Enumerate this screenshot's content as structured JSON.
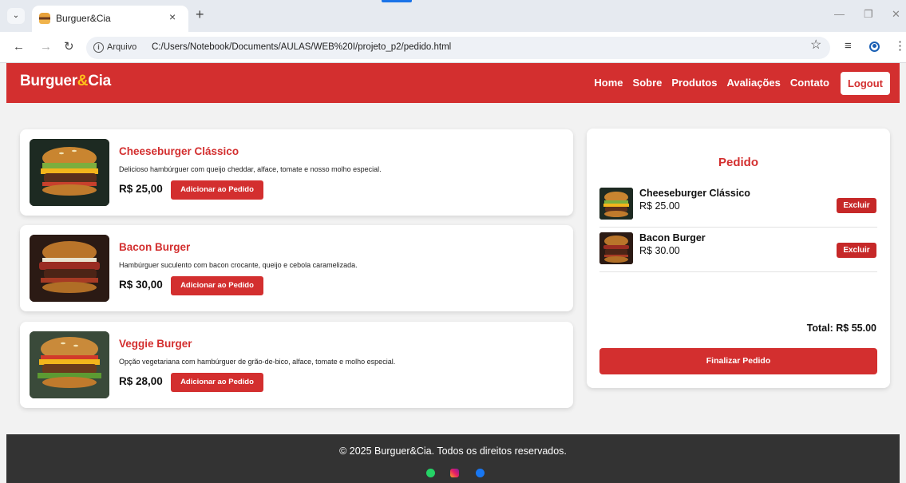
{
  "browser": {
    "tab_title": "Burguer&Cia",
    "tab_close": "×",
    "new_tab": "+",
    "info_label": "i",
    "security_label": "Arquivo",
    "url": "C:/Users/Notebook/Documents/AULAS/WEB%20I/projeto_p2/pedido.html"
  },
  "site": {
    "logo_prefix": "Burguer",
    "logo_amp": "&",
    "logo_suffix": "Cia",
    "brand_color": "#d32f2f",
    "accent_color": "#ffc21a"
  },
  "nav": {
    "items": [
      {
        "label": "Home"
      },
      {
        "label": "Sobre"
      },
      {
        "label": "Produtos"
      },
      {
        "label": "Avaliações"
      },
      {
        "label": "Contato"
      }
    ],
    "logout_label": "Logout"
  },
  "products": [
    {
      "name": "Cheeseburger Clássico",
      "description": "Delicioso hambúrguer com queijo cheddar, alface, tomate e nosso molho especial.",
      "price": "R$ 25,00",
      "button": "Adicionar ao Pedido"
    },
    {
      "name": "Bacon Burger",
      "description": "Hambúrguer suculento com bacon crocante, queijo e cebola caramelizada.",
      "price": "R$ 30,00",
      "button": "Adicionar ao Pedido"
    },
    {
      "name": "Veggie Burger",
      "description": "Opção vegetariana com hambúrguer de grão-de-bico, alface, tomate e molho especial.",
      "price": "R$ 28,00",
      "button": "Adicionar ao Pedido"
    }
  ],
  "order": {
    "title": "Pedido",
    "items": [
      {
        "name": "Cheeseburger Clássico",
        "price": "R$ 25.00",
        "button": "Excluir"
      },
      {
        "name": "Bacon Burger",
        "price": "R$ 30.00",
        "button": "Excluir"
      }
    ],
    "total": "Total: R$ 55.00",
    "finalize_label": "Finalizar Pedido"
  },
  "footer": {
    "copyright": "© 2025 Burguer&Cia. Todos os direitos reservados.",
    "social_icons": [
      "whatsapp-icon",
      "instagram-icon",
      "facebook-icon"
    ]
  }
}
